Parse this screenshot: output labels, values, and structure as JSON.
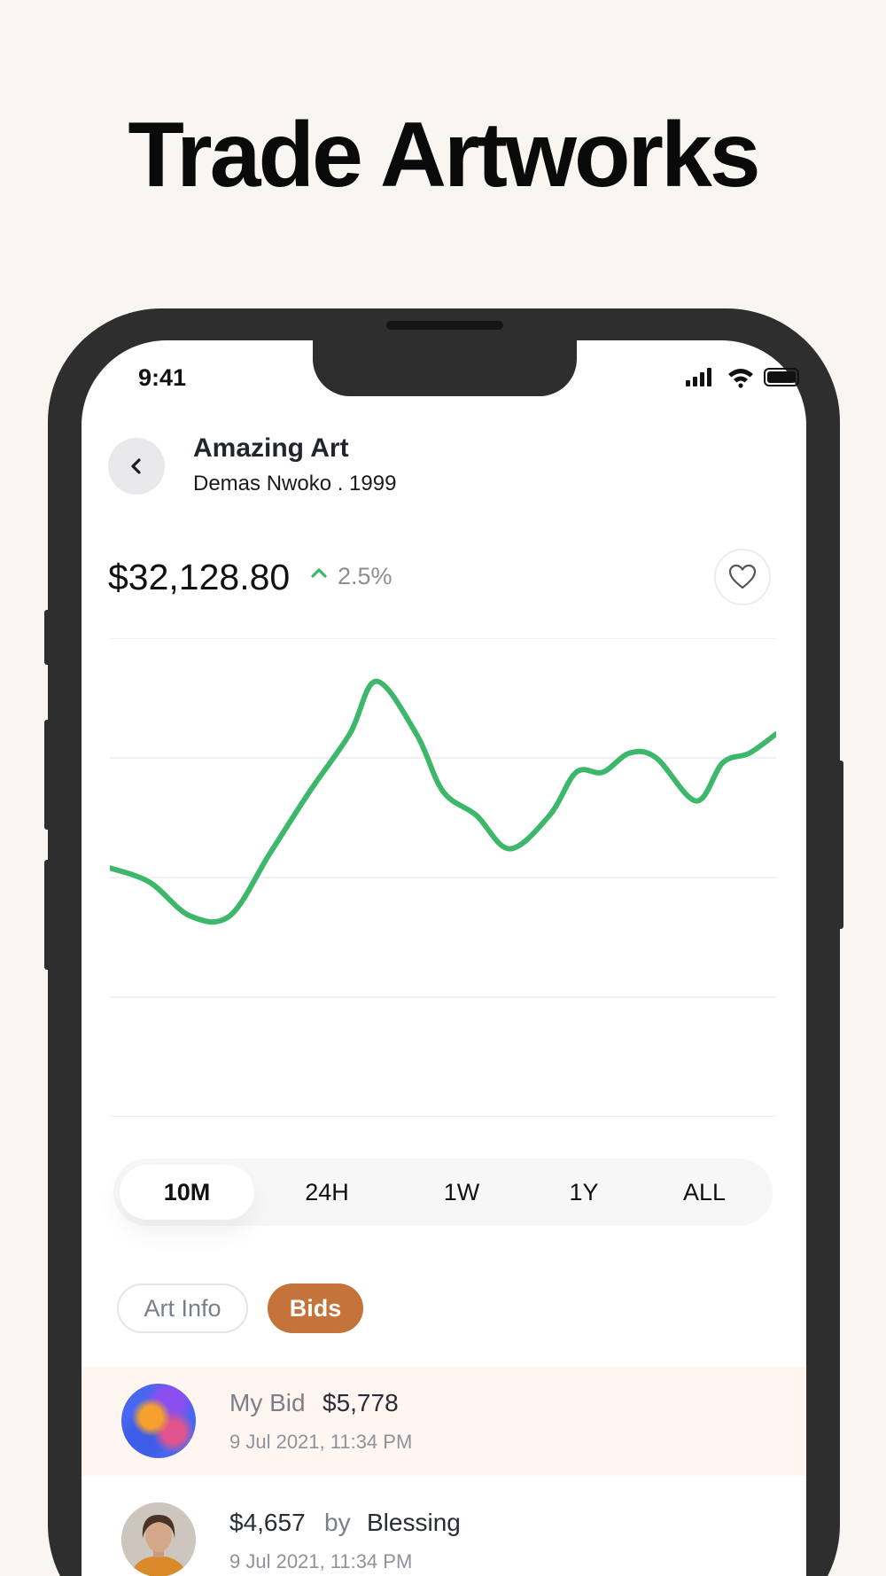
{
  "headline": "Trade Artworks",
  "status_bar": {
    "time": "9:41"
  },
  "artwork": {
    "title": "Amazing Art",
    "subtitle": "Demas Nwoko . 1999"
  },
  "price": {
    "value": "$32,128.80",
    "change": "2.5%",
    "trend": "up",
    "trend_color": "#3db86b"
  },
  "chart_data": {
    "type": "line",
    "title": "",
    "xlabel": "",
    "ylabel": "",
    "grid": true,
    "color": "#3db86b",
    "ylim": [
      0,
      100
    ],
    "series": [
      {
        "points": [
          [
            0,
            52
          ],
          [
            6,
            49
          ],
          [
            12,
            42
          ],
          [
            18,
            42
          ],
          [
            24,
            55
          ],
          [
            30,
            68
          ],
          [
            36,
            80
          ],
          [
            40,
            91
          ],
          [
            46,
            80
          ],
          [
            50,
            68
          ],
          [
            55,
            63
          ],
          [
            60,
            56
          ],
          [
            66,
            63
          ],
          [
            70,
            72
          ],
          [
            74,
            72
          ],
          [
            78,
            76
          ],
          [
            82,
            75
          ],
          [
            88,
            66
          ],
          [
            92,
            74
          ],
          [
            96,
            76
          ],
          [
            100,
            80
          ]
        ]
      }
    ]
  },
  "ranges": [
    {
      "label": "10M",
      "active": true
    },
    {
      "label": "24H",
      "active": false
    },
    {
      "label": "1W",
      "active": false
    },
    {
      "label": "1Y",
      "active": false
    },
    {
      "label": "ALL",
      "active": false
    }
  ],
  "tabs": {
    "art_info": "Art Info",
    "bids": "Bids"
  },
  "bids": [
    {
      "label": "My Bid",
      "amount": "$5,778",
      "time": "9 Jul 2021, 11:34 PM"
    },
    {
      "amount": "$4,657",
      "by": "by",
      "name": "Blessing",
      "time": "9 Jul 2021, 11:34 PM"
    }
  ],
  "colors": {
    "accent": "#c4733a",
    "highlight_row": "#fff6f2",
    "chart_line": "#3db86b"
  },
  "icons": {
    "back": "chevron-left-icon",
    "favorite": "heart-icon",
    "trend": "chevron-up-icon",
    "signal": "signal-icon",
    "wifi": "wifi-icon",
    "battery": "battery-icon"
  }
}
